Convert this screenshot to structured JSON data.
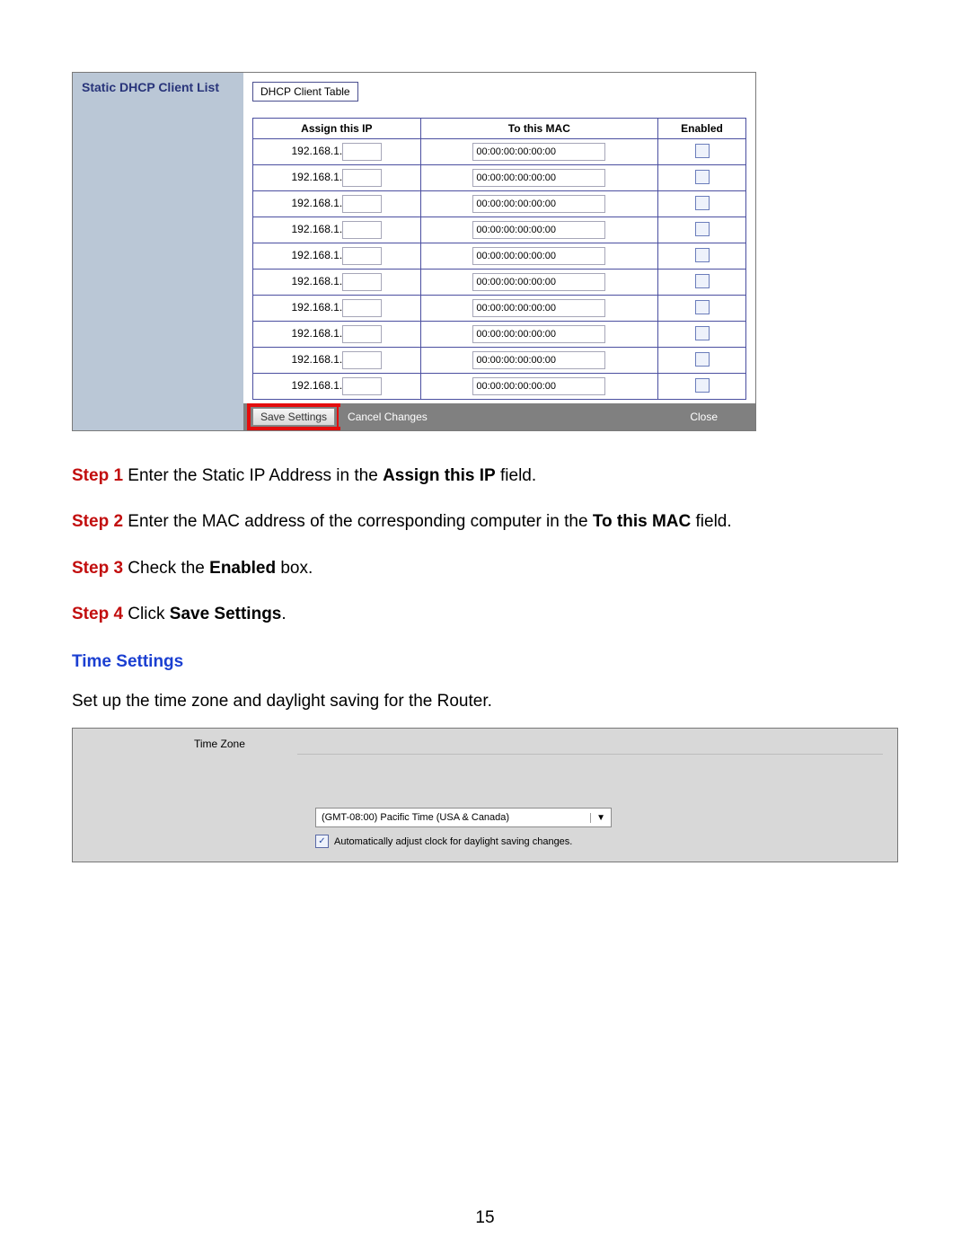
{
  "dhcp": {
    "header": "Static DHCP Client List",
    "button": "DHCP Client Table",
    "columns": {
      "ip": "Assign this IP",
      "mac": "To this MAC",
      "enabled": "Enabled"
    },
    "ip_prefix": "192.168.1.",
    "rows": [
      {
        "ip": "",
        "mac": "00:00:00:00:00:00"
      },
      {
        "ip": "",
        "mac": "00:00:00:00:00:00"
      },
      {
        "ip": "",
        "mac": "00:00:00:00:00:00"
      },
      {
        "ip": "",
        "mac": "00:00:00:00:00:00"
      },
      {
        "ip": "",
        "mac": "00:00:00:00:00:00"
      },
      {
        "ip": "",
        "mac": "00:00:00:00:00:00"
      },
      {
        "ip": "",
        "mac": "00:00:00:00:00:00"
      },
      {
        "ip": "",
        "mac": "00:00:00:00:00:00"
      },
      {
        "ip": "",
        "mac": "00:00:00:00:00:00"
      },
      {
        "ip": "",
        "mac": "00:00:00:00:00:00"
      }
    ],
    "save": "Save Settings",
    "cancel": "Cancel Changes",
    "close": "Close"
  },
  "instructions": {
    "s1a": "Step 1",
    "s1b": " Enter the Static IP Address in the ",
    "s1c": "Assign this IP",
    "s1d": " field.",
    "s2a": "Step 2",
    "s2b": " Enter the MAC address of the corresponding computer in the ",
    "s2c": "To this MAC",
    "s2d": " field.",
    "s3a": "Step 3",
    "s3b": " Check the ",
    "s3c": "Enabled",
    "s3d": " box.",
    "s4a": "Step 4",
    "s4b": " Click ",
    "s4c": "Save Settings",
    "s4d": "."
  },
  "time": {
    "heading": "Time Settings",
    "intro": "Set up the time zone and daylight saving for the Router.",
    "label": "Time Zone",
    "selected": "(GMT-08:00) Pacific Time (USA & Canada)",
    "dst": "Automatically adjust clock for daylight saving changes.",
    "check": "✓"
  },
  "page": "15"
}
